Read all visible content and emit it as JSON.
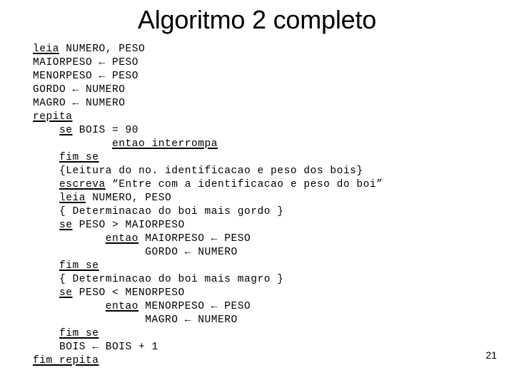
{
  "slide": {
    "title": "Algoritmo 2 completo",
    "page_number": "21",
    "background_color": "#ffffff",
    "text_color": "#000000"
  },
  "code": {
    "language": "portugol",
    "lines": [
      {
        "indent": "",
        "segments": [
          {
            "text": "leia",
            "keyword": true
          },
          {
            "text": " NUMERO, PESO",
            "keyword": false
          }
        ]
      },
      {
        "indent": "",
        "segments": [
          {
            "text": "MAIORPESO ← PESO",
            "keyword": false
          }
        ]
      },
      {
        "indent": "",
        "segments": [
          {
            "text": "MENORPESO ← PESO",
            "keyword": false
          }
        ]
      },
      {
        "indent": "",
        "segments": [
          {
            "text": "GORDO ← NUMERO",
            "keyword": false
          }
        ]
      },
      {
        "indent": "",
        "segments": [
          {
            "text": "MAGRO ← NUMERO",
            "keyword": false
          }
        ]
      },
      {
        "indent": "",
        "segments": [
          {
            "text": "repita",
            "keyword": true
          }
        ]
      },
      {
        "indent": "    ",
        "segments": [
          {
            "text": "se",
            "keyword": true
          },
          {
            "text": " BOIS = 90",
            "keyword": false
          }
        ]
      },
      {
        "indent": "            ",
        "segments": [
          {
            "text": "entao interrompa",
            "keyword": true
          }
        ]
      },
      {
        "indent": "    ",
        "segments": [
          {
            "text": "fim se",
            "keyword": true
          }
        ]
      },
      {
        "indent": "    ",
        "segments": [
          {
            "text": "{Leitura do no. identificacao e peso dos bois}",
            "keyword": false
          }
        ]
      },
      {
        "indent": "    ",
        "segments": [
          {
            "text": "escreva",
            "keyword": true
          },
          {
            "text": " “Entre com a identificacao e peso do boi”",
            "keyword": false
          }
        ]
      },
      {
        "indent": "    ",
        "segments": [
          {
            "text": "leia",
            "keyword": true
          },
          {
            "text": " NUMERO, PESO",
            "keyword": false
          }
        ]
      },
      {
        "indent": "    ",
        "segments": [
          {
            "text": "{ Determinacao do boi mais gordo }",
            "keyword": false
          }
        ]
      },
      {
        "indent": "    ",
        "segments": [
          {
            "text": "se",
            "keyword": true
          },
          {
            "text": " PESO > MAIORPESO",
            "keyword": false
          }
        ]
      },
      {
        "indent": "           ",
        "segments": [
          {
            "text": "entao",
            "keyword": true
          },
          {
            "text": " MAIORPESO ← PESO",
            "keyword": false
          }
        ]
      },
      {
        "indent": "                 ",
        "segments": [
          {
            "text": "GORDO ← NUMERO",
            "keyword": false
          }
        ]
      },
      {
        "indent": "    ",
        "segments": [
          {
            "text": "fim se",
            "keyword": true
          }
        ]
      },
      {
        "indent": "    ",
        "segments": [
          {
            "text": "{ Determinacao do boi mais magro }",
            "keyword": false
          }
        ]
      },
      {
        "indent": "    ",
        "segments": [
          {
            "text": "se",
            "keyword": true
          },
          {
            "text": " PESO < MENORPESO",
            "keyword": false
          }
        ]
      },
      {
        "indent": "           ",
        "segments": [
          {
            "text": "entao",
            "keyword": true
          },
          {
            "text": " MENORPESO ← PESO",
            "keyword": false
          }
        ]
      },
      {
        "indent": "                 ",
        "segments": [
          {
            "text": "MAGRO ← NUMERO",
            "keyword": false
          }
        ]
      },
      {
        "indent": "    ",
        "segments": [
          {
            "text": "fim se",
            "keyword": true
          }
        ]
      },
      {
        "indent": "    ",
        "segments": [
          {
            "text": "BOIS ← BOIS + 1",
            "keyword": false
          }
        ]
      },
      {
        "indent": "",
        "segments": [
          {
            "text": "fim repita",
            "keyword": true
          }
        ]
      }
    ]
  }
}
